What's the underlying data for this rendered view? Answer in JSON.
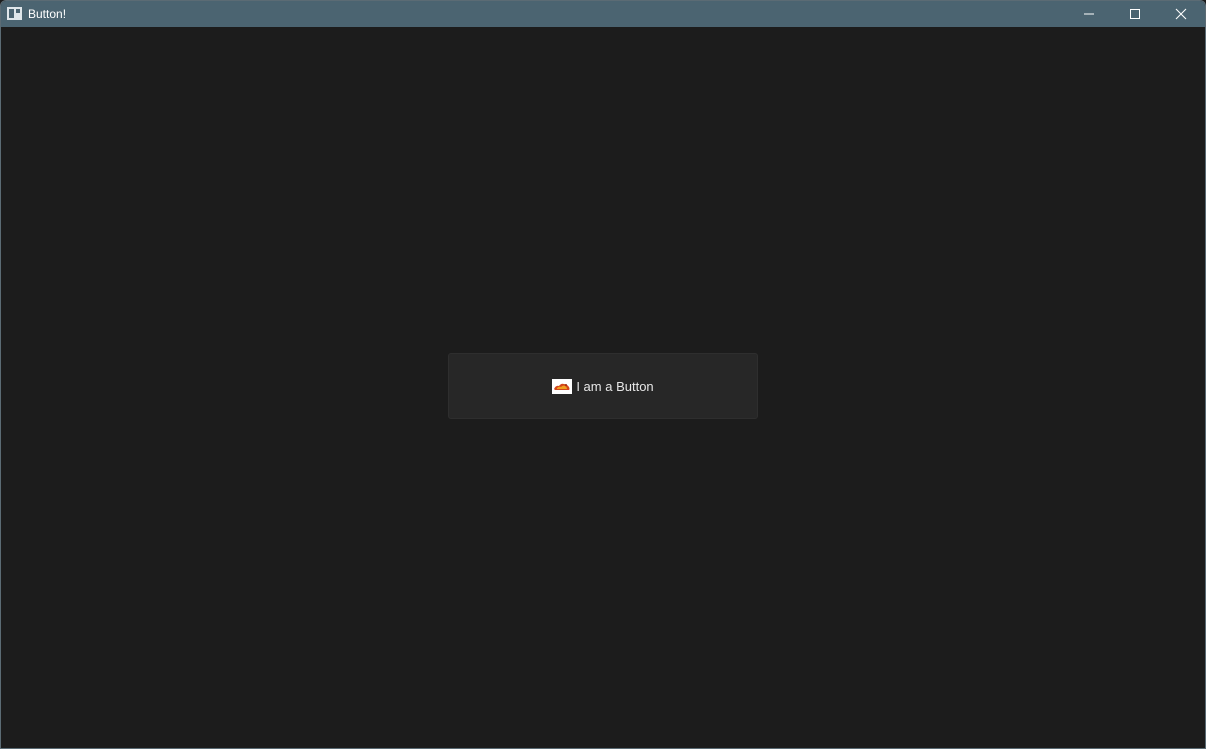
{
  "window": {
    "title": "Button!",
    "icon": "window-app-icon",
    "controls": {
      "minimize": "minimize-icon",
      "maximize": "maximize-icon",
      "close": "close-icon"
    }
  },
  "main": {
    "button_label": "I am a Button",
    "button_icon": "image-icon"
  },
  "colors": {
    "titlebar": "#4b6471",
    "background": "#1c1c1c",
    "button_bg": "#272727",
    "button_text": "#e6e6e6"
  }
}
